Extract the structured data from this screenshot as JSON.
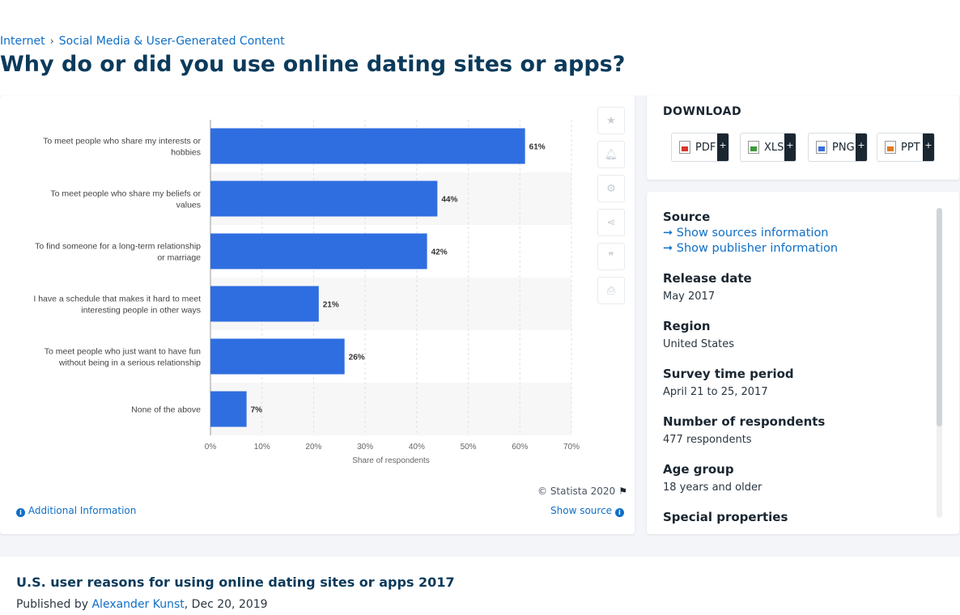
{
  "breadcrumb": {
    "item1": "Internet",
    "item2": "Social Media & User-Generated Content"
  },
  "page_title": "Why do or did you use online dating sites or apps?",
  "chart_data": {
    "type": "bar",
    "orientation": "horizontal",
    "categories": [
      [
        "To meet people who share my interests or",
        "hobbies"
      ],
      [
        "To meet people who share my beliefs or",
        "values"
      ],
      [
        "To find someone for a long-term relationship",
        "or marriage"
      ],
      [
        "I have a schedule that makes it hard to meet",
        "interesting people in other ways"
      ],
      [
        "To meet people who just want to have fun",
        "without being in a serious relationship"
      ],
      [
        "None of the above"
      ]
    ],
    "values": [
      61,
      44,
      42,
      21,
      26,
      7
    ],
    "value_labels": [
      "61%",
      "44%",
      "42%",
      "21%",
      "26%",
      "7%"
    ],
    "xlim": [
      0,
      70
    ],
    "xticks": [
      "0%",
      "10%",
      "20%",
      "30%",
      "40%",
      "50%",
      "60%",
      "70%"
    ],
    "xlabel": "Share of respondents",
    "grid": true,
    "bar_color": "#2f6ee0"
  },
  "tools": [
    "favorite-icon",
    "bell-icon",
    "gear-icon",
    "share-icon",
    "quote-icon",
    "print-icon"
  ],
  "copyright": "© Statista 2020",
  "additional_info": "Additional Information",
  "show_source": "Show source",
  "download": {
    "title": "DOWNLOAD",
    "buttons": [
      {
        "label": "PDF",
        "color": "#d9342b"
      },
      {
        "label": "XLS",
        "color": "#3a9a3a"
      },
      {
        "label": "PNG",
        "color": "#3a6fd8"
      },
      {
        "label": "PPT",
        "color": "#e07b1f"
      }
    ],
    "plus": "+"
  },
  "meta": {
    "source_label": "Source",
    "show_sources": "Show sources information",
    "show_publisher": "Show publisher information",
    "release_label": "Release date",
    "release_value": "May 2017",
    "region_label": "Region",
    "region_value": "United States",
    "survey_label": "Survey time period",
    "survey_value": "April 21 to 25, 2017",
    "respondents_label": "Number of respondents",
    "respondents_value": "477 respondents",
    "age_label": "Age group",
    "age_value": "18 years and older",
    "special_label": "Special properties"
  },
  "statistic_title": "U.S. user reasons for using online dating sites or apps 2017",
  "published_prefix": "Published by",
  "author": "Alexander Kunst",
  "published_date": ", Dec 20, 2019"
}
